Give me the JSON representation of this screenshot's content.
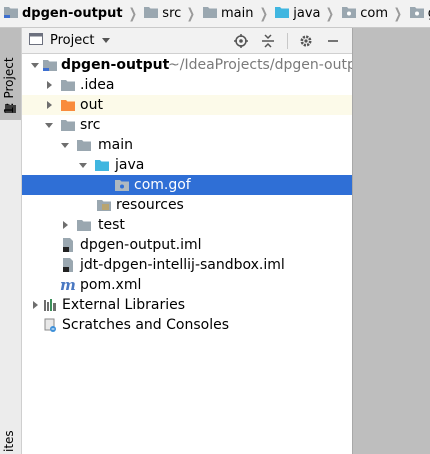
{
  "navbar": {
    "crumbs": [
      {
        "label": "dpgen-output",
        "icon": "module-folder-icon",
        "bold": true
      },
      {
        "label": "src",
        "icon": "folder-icon"
      },
      {
        "label": "main",
        "icon": "folder-icon"
      },
      {
        "label": "java",
        "icon": "source-folder-icon"
      },
      {
        "label": "com",
        "icon": "package-icon"
      },
      {
        "label": "gof",
        "icon": "package-icon"
      }
    ]
  },
  "stripe": {
    "project_tab": "1: Project",
    "bottom_tab": "ites"
  },
  "panel": {
    "title": "Project",
    "icons": [
      "locate-icon",
      "collapse-all-icon",
      "settings-icon",
      "hide-icon"
    ]
  },
  "tree": [
    {
      "label": "dpgen-output",
      "secondary": "~/IdeaProjects/dpgen-output",
      "icon": "module-folder-icon",
      "arrow": "down",
      "level": 0
    },
    {
      "label": ".idea",
      "icon": "folder-icon",
      "arrow": "right",
      "level": 1
    },
    {
      "label": "out",
      "icon": "excluded-folder-icon",
      "arrow": "right",
      "level": 1,
      "highlighted": true
    },
    {
      "label": "src",
      "icon": "folder-icon",
      "arrow": "down",
      "level": 1
    },
    {
      "label": "main",
      "icon": "folder-icon",
      "arrow": "down",
      "level": 2
    },
    {
      "label": "java",
      "icon": "source-folder-icon",
      "arrow": "down",
      "level": 3
    },
    {
      "label": "com.gof",
      "icon": "package-icon",
      "arrow": "none",
      "level": 4,
      "selected": true
    },
    {
      "label": "resources",
      "icon": "resources-folder-icon",
      "arrow": "none",
      "level": 3
    },
    {
      "label": "test",
      "icon": "folder-icon",
      "arrow": "right",
      "level": 2
    },
    {
      "label": "dpgen-output.iml",
      "icon": "iml-file-icon",
      "arrow": "none",
      "level": 1
    },
    {
      "label": "jdt-dpgen-intellij-sandbox.iml",
      "icon": "iml-file-icon",
      "arrow": "none",
      "level": 1
    },
    {
      "label": "pom.xml",
      "icon": "maven-file-icon",
      "arrow": "none",
      "level": 1
    },
    {
      "label": "External Libraries",
      "icon": "libraries-icon",
      "arrow": "right",
      "level": 0
    },
    {
      "label": "Scratches and Consoles",
      "icon": "scratches-icon",
      "arrow": "none",
      "level": 0
    }
  ],
  "colors": {
    "selection": "#2f6fd6",
    "highlight": "#fcfae9",
    "folder": "#9aa7b0",
    "source_folder": "#40b6e0",
    "excluded_folder": "#f98b3c",
    "editor_background": "#bebebe"
  }
}
